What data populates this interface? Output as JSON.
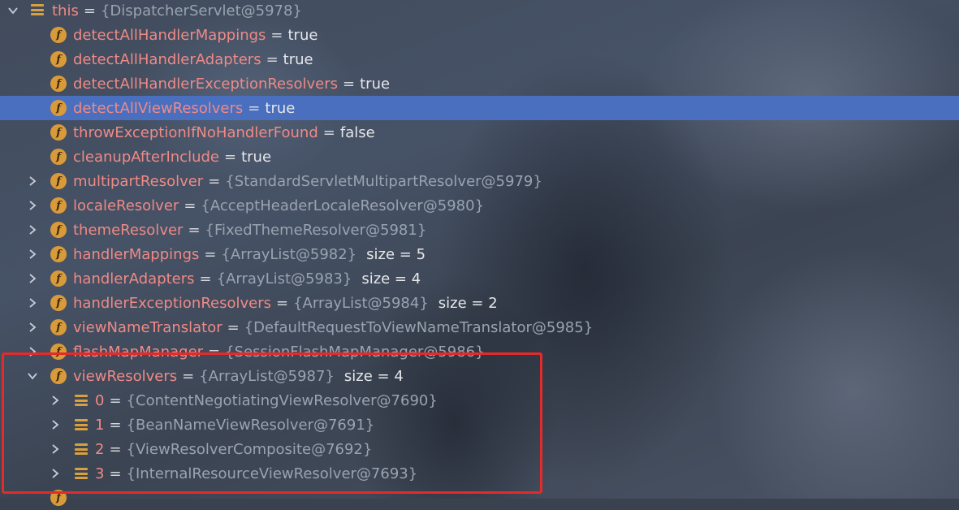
{
  "tree": {
    "root": {
      "name": "this",
      "value": "{DispatcherServlet@5978}"
    },
    "fields": [
      {
        "name": "detectAllHandlerMappings",
        "value": "true",
        "expandable": false,
        "selected": false
      },
      {
        "name": "detectAllHandlerAdapters",
        "value": "true",
        "expandable": false,
        "selected": false
      },
      {
        "name": "detectAllHandlerExceptionResolvers",
        "value": "true",
        "expandable": false,
        "selected": false
      },
      {
        "name": "detectAllViewResolvers",
        "value": "true",
        "expandable": false,
        "selected": true
      },
      {
        "name": "throwExceptionIfNoHandlerFound",
        "value": "false",
        "expandable": false,
        "selected": false
      },
      {
        "name": "cleanupAfterInclude",
        "value": "true",
        "expandable": false,
        "selected": false
      },
      {
        "name": "multipartResolver",
        "value": "{StandardServletMultipartResolver@5979}",
        "expandable": true,
        "selected": false
      },
      {
        "name": "localeResolver",
        "value": "{AcceptHeaderLocaleResolver@5980}",
        "expandable": true,
        "selected": false
      },
      {
        "name": "themeResolver",
        "value": "{FixedThemeResolver@5981}",
        "expandable": true,
        "selected": false
      },
      {
        "name": "handlerMappings",
        "value": "{ArrayList@5982}",
        "size": "size = 5",
        "expandable": true,
        "selected": false
      },
      {
        "name": "handlerAdapters",
        "value": "{ArrayList@5983}",
        "size": "size = 4",
        "expandable": true,
        "selected": false
      },
      {
        "name": "handlerExceptionResolvers",
        "value": "{ArrayList@5984}",
        "size": "size = 2",
        "expandable": true,
        "selected": false
      },
      {
        "name": "viewNameTranslator",
        "value": "{DefaultRequestToViewNameTranslator@5985}",
        "expandable": true,
        "selected": false
      },
      {
        "name": "flashMapManager",
        "value": "{SessionFlashMapManager@5986}",
        "expandable": true,
        "selected": false
      },
      {
        "name": "viewResolvers",
        "value": "{ArrayList@5987}",
        "size": "size = 4",
        "expandable": true,
        "expanded": true,
        "selected": false
      }
    ],
    "viewResolvers_children": [
      {
        "index": "0",
        "value": "{ContentNegotiatingViewResolver@7690}"
      },
      {
        "index": "1",
        "value": "{BeanNameViewResolver@7691}"
      },
      {
        "index": "2",
        "value": "{ViewResolverComposite@7692}"
      },
      {
        "index": "3",
        "value": "{InternalResourceViewResolver@7693}"
      }
    ],
    "field_icon_letter": "f",
    "eq": "="
  },
  "colors": {
    "field_name": "#ef8a86",
    "object_ref": "#9aa3b0",
    "selection": "#4a6fbf",
    "field_icon": "#d99b3a",
    "highlight_box": "#e32b2b"
  }
}
